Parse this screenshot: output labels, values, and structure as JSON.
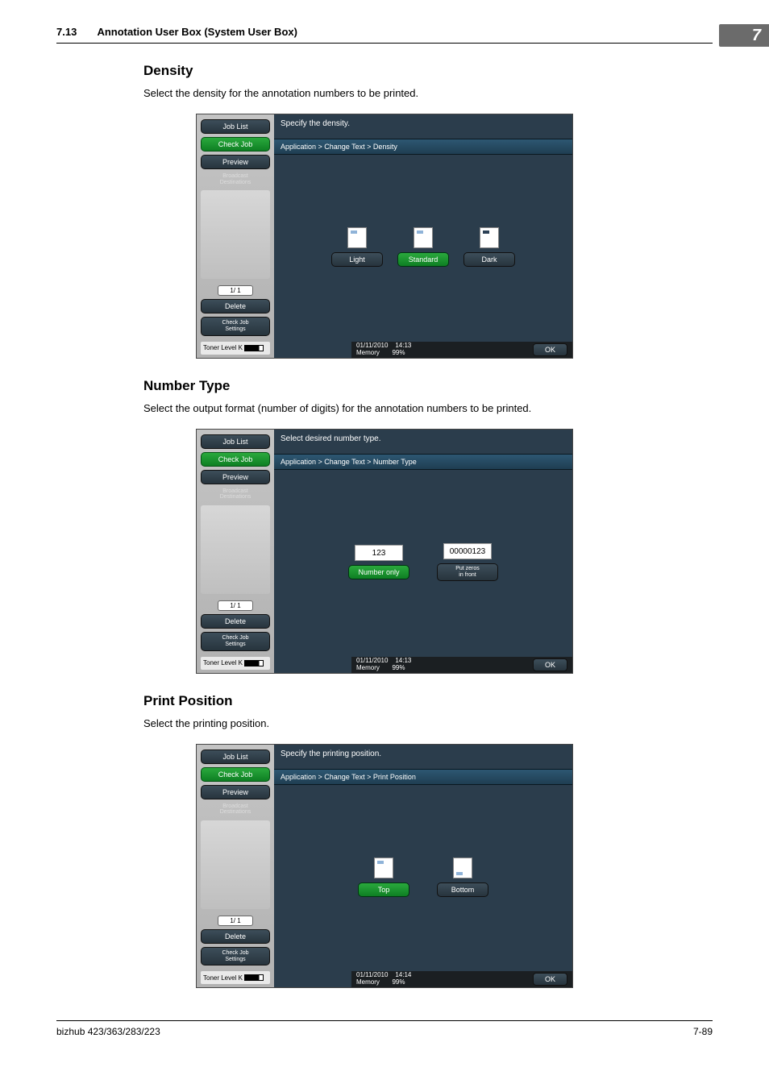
{
  "header": {
    "section_number": "7.13",
    "section_title": "Annotation User Box (System User Box)",
    "chapter_number": "7"
  },
  "sections": [
    {
      "heading": "Density",
      "para": "Select the density for the annotation numbers to be printed."
    },
    {
      "heading": "Number Type",
      "para": "Select the output format (number of digits) for the annotation numbers to be printed."
    },
    {
      "heading": "Print Position",
      "para": "Select the printing position."
    }
  ],
  "common": {
    "job_list": "Job List",
    "check_job": "Check Job",
    "preview": "Preview",
    "broadcast": "Broadcast\nDestinations",
    "pager": "1/   1",
    "delete": "Delete",
    "check_settings": "Check Job\nSettings",
    "toner_label": "Toner Level",
    "toner_k": "K",
    "ok": "OK",
    "date": "01/11/2010",
    "memory": "Memory",
    "mem_pct": "99%"
  },
  "panels": {
    "density": {
      "title": "Specify the density.",
      "crumb": "Application > Change Text > Density",
      "time": "14:13",
      "options": [
        {
          "label": "Light",
          "kind": "dark",
          "icon": "light"
        },
        {
          "label": "Standard",
          "kind": "green",
          "icon": "standard"
        },
        {
          "label": "Dark",
          "kind": "dark",
          "icon": "dark"
        }
      ]
    },
    "number_type": {
      "title": "Select desired number type.",
      "crumb": "Application > Change Text > Number Type",
      "time": "14:13",
      "options": [
        {
          "num": "123",
          "label": "Number only",
          "kind": "green"
        },
        {
          "num": "00000123",
          "label": "Put zeros\nin front",
          "kind": "dark"
        }
      ]
    },
    "print_position": {
      "title": "Specify the printing position.",
      "crumb": "Application > Change Text > Print Position",
      "time": "14:14",
      "options": [
        {
          "label": "Top",
          "kind": "green",
          "icon": "top"
        },
        {
          "label": "Bottom",
          "kind": "dark",
          "icon": "bottom"
        }
      ]
    }
  },
  "footer": {
    "product": "bizhub 423/363/283/223",
    "page": "7-89"
  }
}
